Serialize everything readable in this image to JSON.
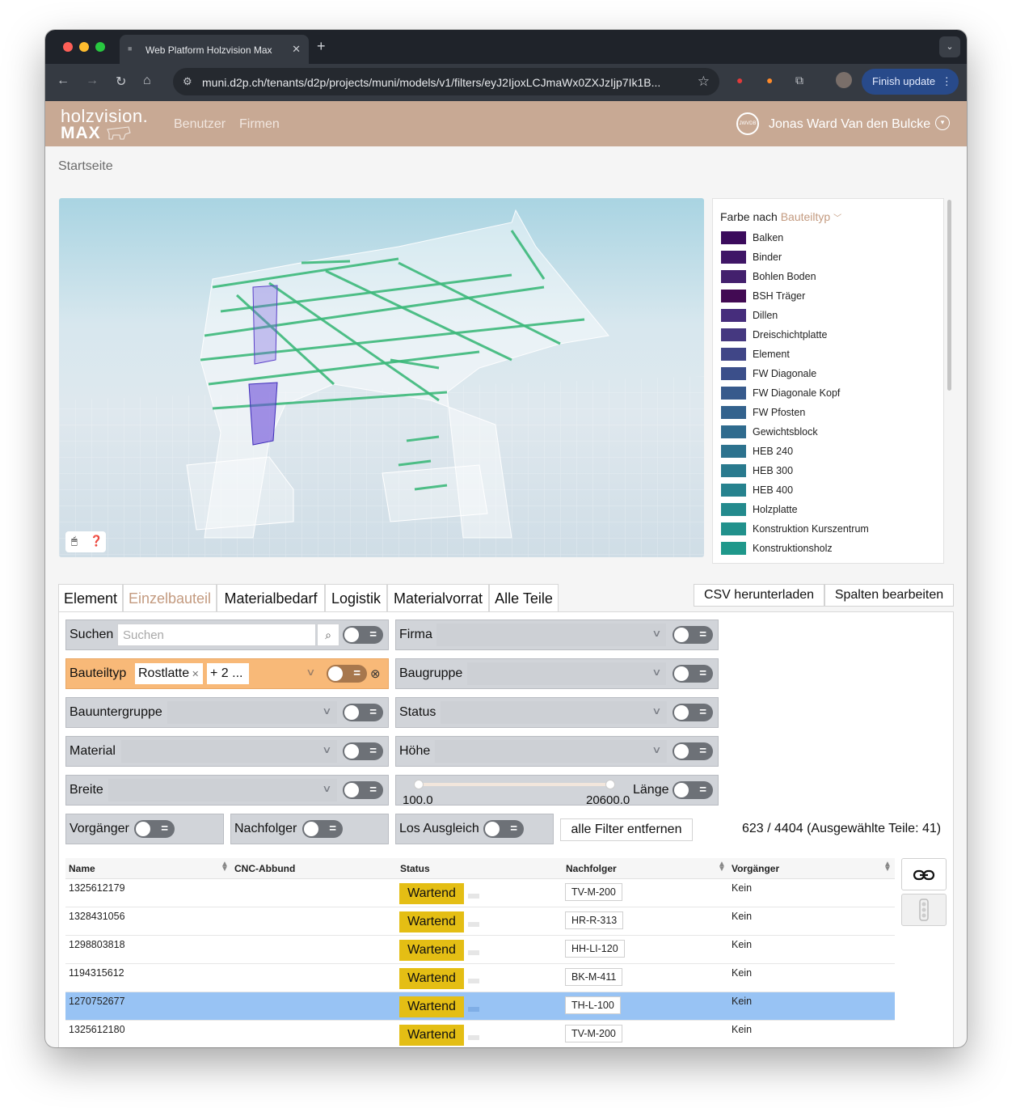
{
  "browser": {
    "tab_title": "Web Platform Holzvision Max",
    "url": "muni.d2p.ch/tenants/d2p/projects/muni/models/v1/filters/eyJ2IjoxLCJmaWx0ZXJzIjp7Ik1B...",
    "finish_update": "Finish update"
  },
  "header": {
    "logo_top": "holzvision.",
    "logo_bottom": "MAX",
    "nav": [
      "Benutzer",
      "Firmen"
    ],
    "user_initials": "JWVDB",
    "user_name": "Jonas Ward Van den Bulcke"
  },
  "breadcrumb": "Startseite",
  "legend": {
    "prefix": "Farbe nach",
    "field": "Bauteiltyp",
    "items": [
      {
        "label": "Balken",
        "color": "#3b0b5c"
      },
      {
        "label": "Binder",
        "color": "#3f1666"
      },
      {
        "label": "Bohlen Boden",
        "color": "#43206d"
      },
      {
        "label": "BSH Träger",
        "color": "#420a53"
      },
      {
        "label": "Dillen",
        "color": "#462d7c"
      },
      {
        "label": "Dreischichtplatte",
        "color": "#453880"
      },
      {
        "label": "Element",
        "color": "#404687"
      },
      {
        "label": "FW Diagonale",
        "color": "#3b4f8a"
      },
      {
        "label": "FW Diagonale Kopf",
        "color": "#375a8c"
      },
      {
        "label": "FW Pfosten",
        "color": "#33628d"
      },
      {
        "label": "Gewichtsblock",
        "color": "#2f6b8e"
      },
      {
        "label": "HEB 240",
        "color": "#2c728e"
      },
      {
        "label": "HEB 300",
        "color": "#297a8e"
      },
      {
        "label": "HEB 400",
        "color": "#26828e"
      },
      {
        "label": "Holzplatte",
        "color": "#238a8d"
      },
      {
        "label": "Konstruktion Kurszentrum",
        "color": "#21918c"
      },
      {
        "label": "Konstruktionsholz",
        "color": "#1f988b"
      }
    ]
  },
  "tabs": [
    "Element",
    "Einzelbauteil",
    "Materialbedarf",
    "Logistik",
    "Materialvorrat",
    "Alle Teile"
  ],
  "buttons": {
    "csv": "CSV herunterladen",
    "columns": "Spalten bearbeiten",
    "clear_filters": "alle Filter entfernen"
  },
  "filters": {
    "suchen": "Suchen",
    "suchen_placeholder": "Suchen",
    "firma": "Firma",
    "bauteiltyp": "Bauteiltyp",
    "bauteiltyp_chip": "Rostlatte",
    "bauteiltyp_more": "+ 2 ...",
    "baugruppe": "Baugruppe",
    "bauuntergruppe": "Bauuntergruppe",
    "status": "Status",
    "material": "Material",
    "hoehe": "Höhe",
    "breite": "Breite",
    "laenge": "Länge",
    "laenge_min": "100.0",
    "laenge_max": "20600.0",
    "vorgaenger": "Vorgänger",
    "nachfolger": "Nachfolger",
    "los_ausgleich": "Los Ausgleich"
  },
  "count": "623 / 4404 (Ausgewählte Teile: 41)",
  "table": {
    "columns": [
      "Name",
      "CNC-Abbund",
      "Status",
      "Nachfolger",
      "Vorgänger"
    ],
    "rows": [
      {
        "name": "1325612179",
        "status": "Wartend",
        "nachfolger": "TV-M-200",
        "vorgaenger": "Kein"
      },
      {
        "name": "1328431056",
        "status": "Wartend",
        "nachfolger": "HR-R-313",
        "vorgaenger": "Kein"
      },
      {
        "name": "1298803818",
        "status": "Wartend",
        "nachfolger": "HH-LI-120",
        "vorgaenger": "Kein"
      },
      {
        "name": "1194315612",
        "status": "Wartend",
        "nachfolger": "BK-M-411",
        "vorgaenger": "Kein"
      },
      {
        "name": "1270752677",
        "status": "Wartend",
        "nachfolger": "TH-L-100",
        "vorgaenger": "Kein"
      },
      {
        "name": "1325612180",
        "status": "Wartend",
        "nachfolger": "TV-M-200",
        "vorgaenger": "Kein"
      }
    ]
  }
}
